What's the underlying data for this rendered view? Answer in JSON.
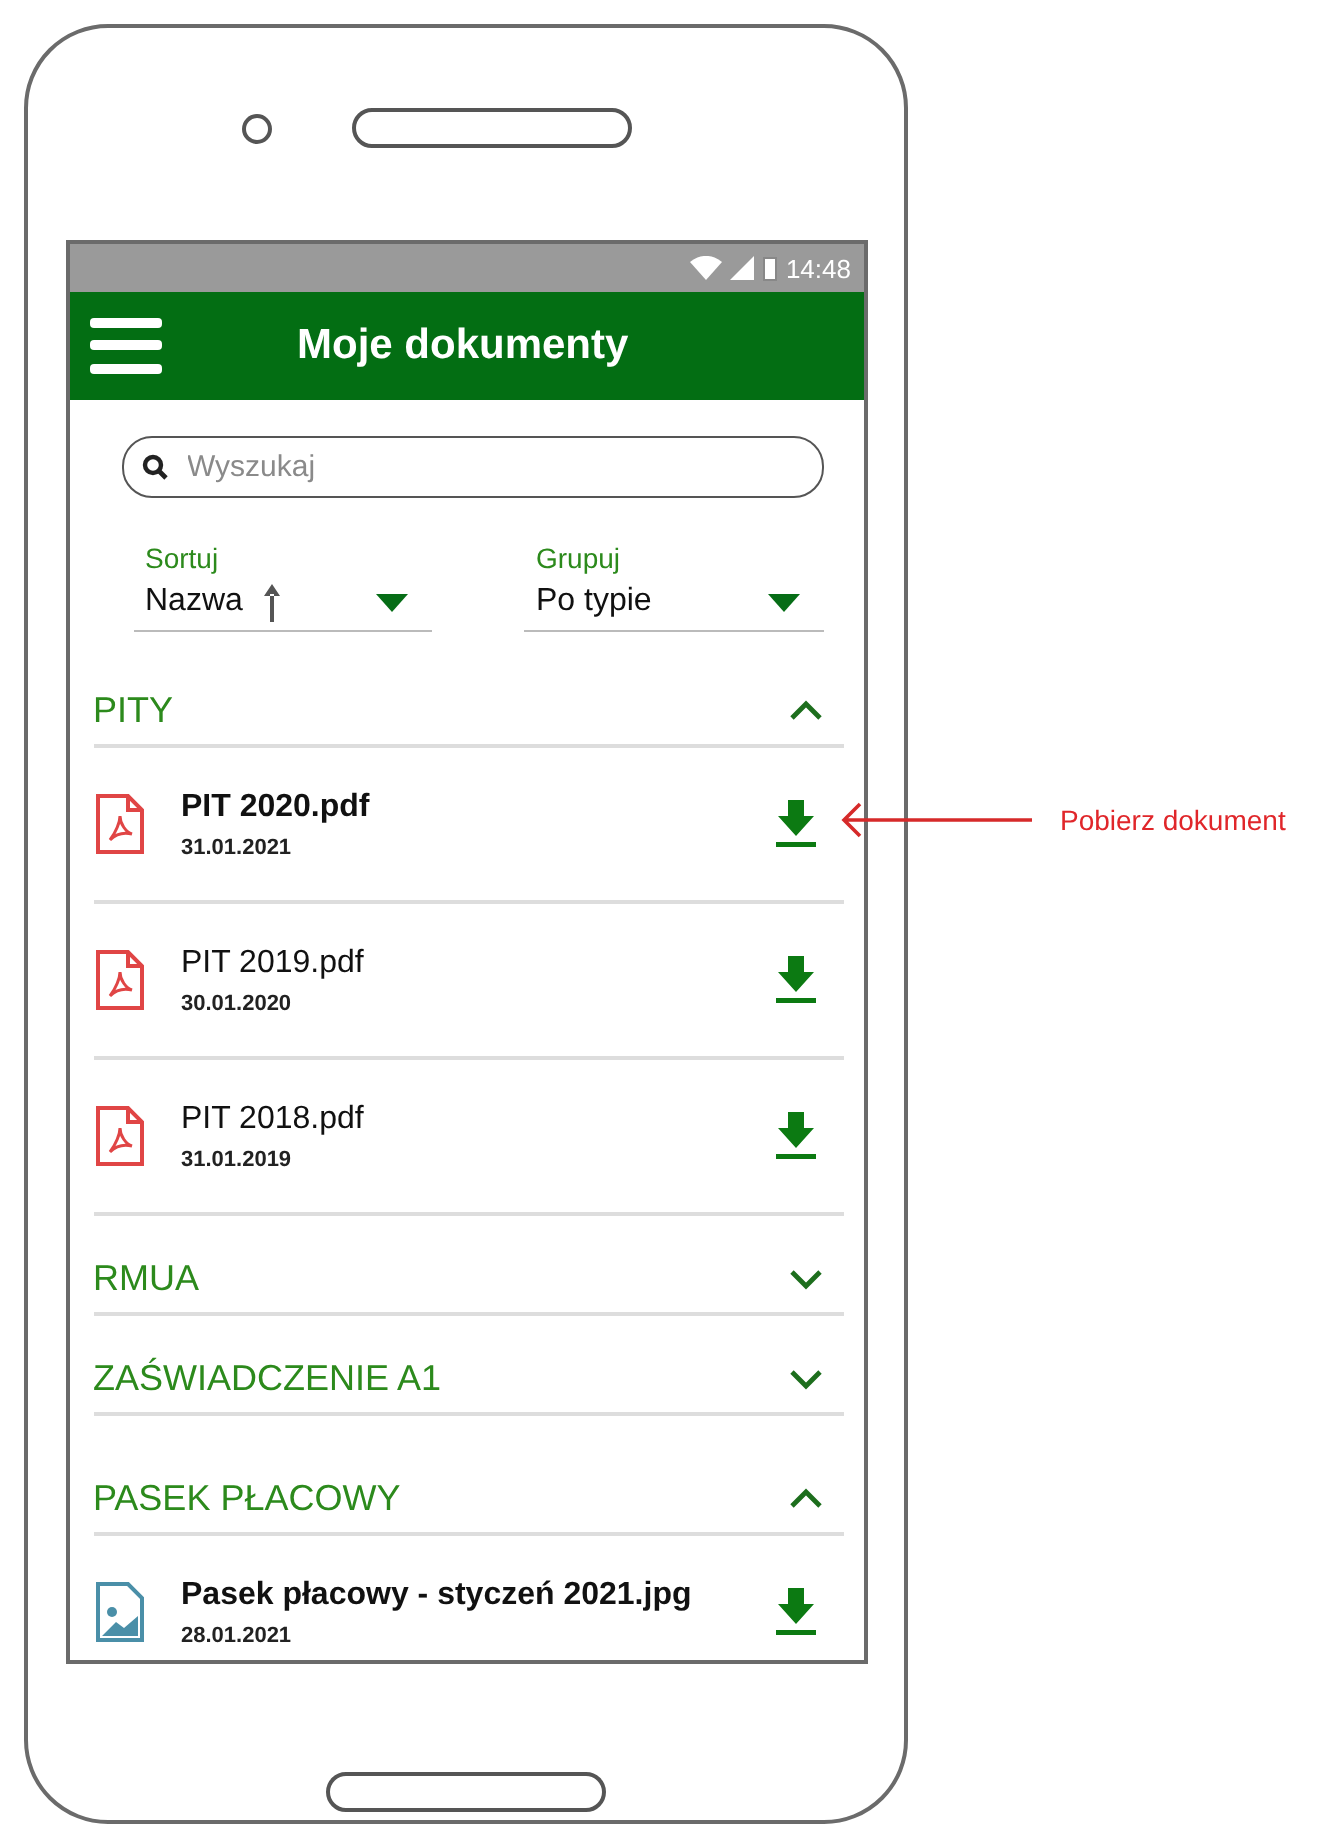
{
  "status_bar": {
    "time": "14:48"
  },
  "header": {
    "title": "Moje dokumenty"
  },
  "search": {
    "placeholder": "Wyszukaj"
  },
  "filters": [
    {
      "label": "Sortuj",
      "value": "Nazwa",
      "ascending": true
    },
    {
      "label": "Grupuj",
      "value": "Po typie"
    }
  ],
  "sections": [
    {
      "title": "PITY",
      "expanded": true,
      "documents": [
        {
          "name": "PIT 2020.pdf",
          "date": "31.01.2021",
          "kind": "pdf",
          "new": true
        },
        {
          "name": "PIT 2019.pdf",
          "date": "30.01.2020",
          "kind": "pdf",
          "new": false
        },
        {
          "name": "PIT 2018.pdf",
          "date": "31.01.2019",
          "kind": "pdf",
          "new": false
        }
      ]
    },
    {
      "title": "RMUA",
      "expanded": false
    },
    {
      "title": "ZAŚWIADCZENIE A1",
      "expanded": false
    },
    {
      "title": "PASEK PŁACOWY",
      "expanded": true,
      "documents": [
        {
          "name": "Pasek płacowy - styczeń 2021.jpg",
          "date": "28.01.2021",
          "kind": "image",
          "new": true
        }
      ]
    }
  ],
  "annotation": {
    "text": "Pobierz dokument"
  }
}
